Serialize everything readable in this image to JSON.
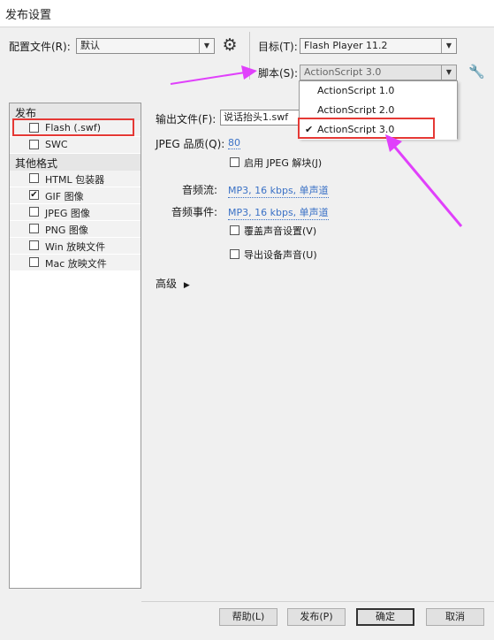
{
  "window": {
    "title": "发布设置"
  },
  "profile": {
    "label": "配置文件(R):",
    "value": "默认"
  },
  "target": {
    "label": "目标(T):",
    "value": "Flash Player 11.2"
  },
  "script": {
    "label": "脚本(S):",
    "value": "ActionScript 3.0",
    "options": [
      {
        "label": "ActionScript 1.0",
        "selected": false
      },
      {
        "label": "ActionScript 2.0",
        "selected": false
      },
      {
        "label": "ActionScript 3.0",
        "selected": true
      }
    ],
    "check_mark": "✔"
  },
  "left_panel": {
    "publish_header": "发布",
    "publish_items": [
      {
        "label": "Flash (.swf)",
        "checked": false
      },
      {
        "label": "SWC",
        "checked": false
      }
    ],
    "other_header": "其他格式",
    "other_items": [
      {
        "label": "HTML 包装器",
        "checked": false
      },
      {
        "label": "GIF 图像",
        "checked": true
      },
      {
        "label": "JPEG 图像",
        "checked": false
      },
      {
        "label": "PNG 图像",
        "checked": false
      },
      {
        "label": "Win 放映文件",
        "checked": false
      },
      {
        "label": "Mac 放映文件",
        "checked": false
      }
    ]
  },
  "settings": {
    "output_file_label": "输出文件(F):",
    "output_file_value": "说话抬头1.swf",
    "jpeg_quality_label": "JPEG 品质(Q):",
    "jpeg_quality_value": "80",
    "enable_jpeg_deblock": "启用 JPEG 解块(J)",
    "audio_stream_label": "音频流:",
    "audio_stream_value": "MP3, 16 kbps, 单声道",
    "audio_event_label": "音频事件:",
    "audio_event_value": "MP3, 16 kbps, 单声道",
    "override_sound": "覆盖声音设置(V)",
    "export_device_sound": "导出设备声音(U)",
    "advanced_label": "高级",
    "advanced_arrow": "▶"
  },
  "buttons": {
    "help": "帮助(L)",
    "publish": "发布(P)",
    "ok": "确定",
    "cancel": "取消"
  },
  "icons": {
    "gear": "⚙",
    "wrench": "🔧",
    "dropdown_arrow": "▼",
    "checkbox_check": "✔"
  },
  "colors": {
    "annotation_arrow": "#e040fb",
    "highlight_box": "#e53935",
    "link": "#3b72c6"
  }
}
